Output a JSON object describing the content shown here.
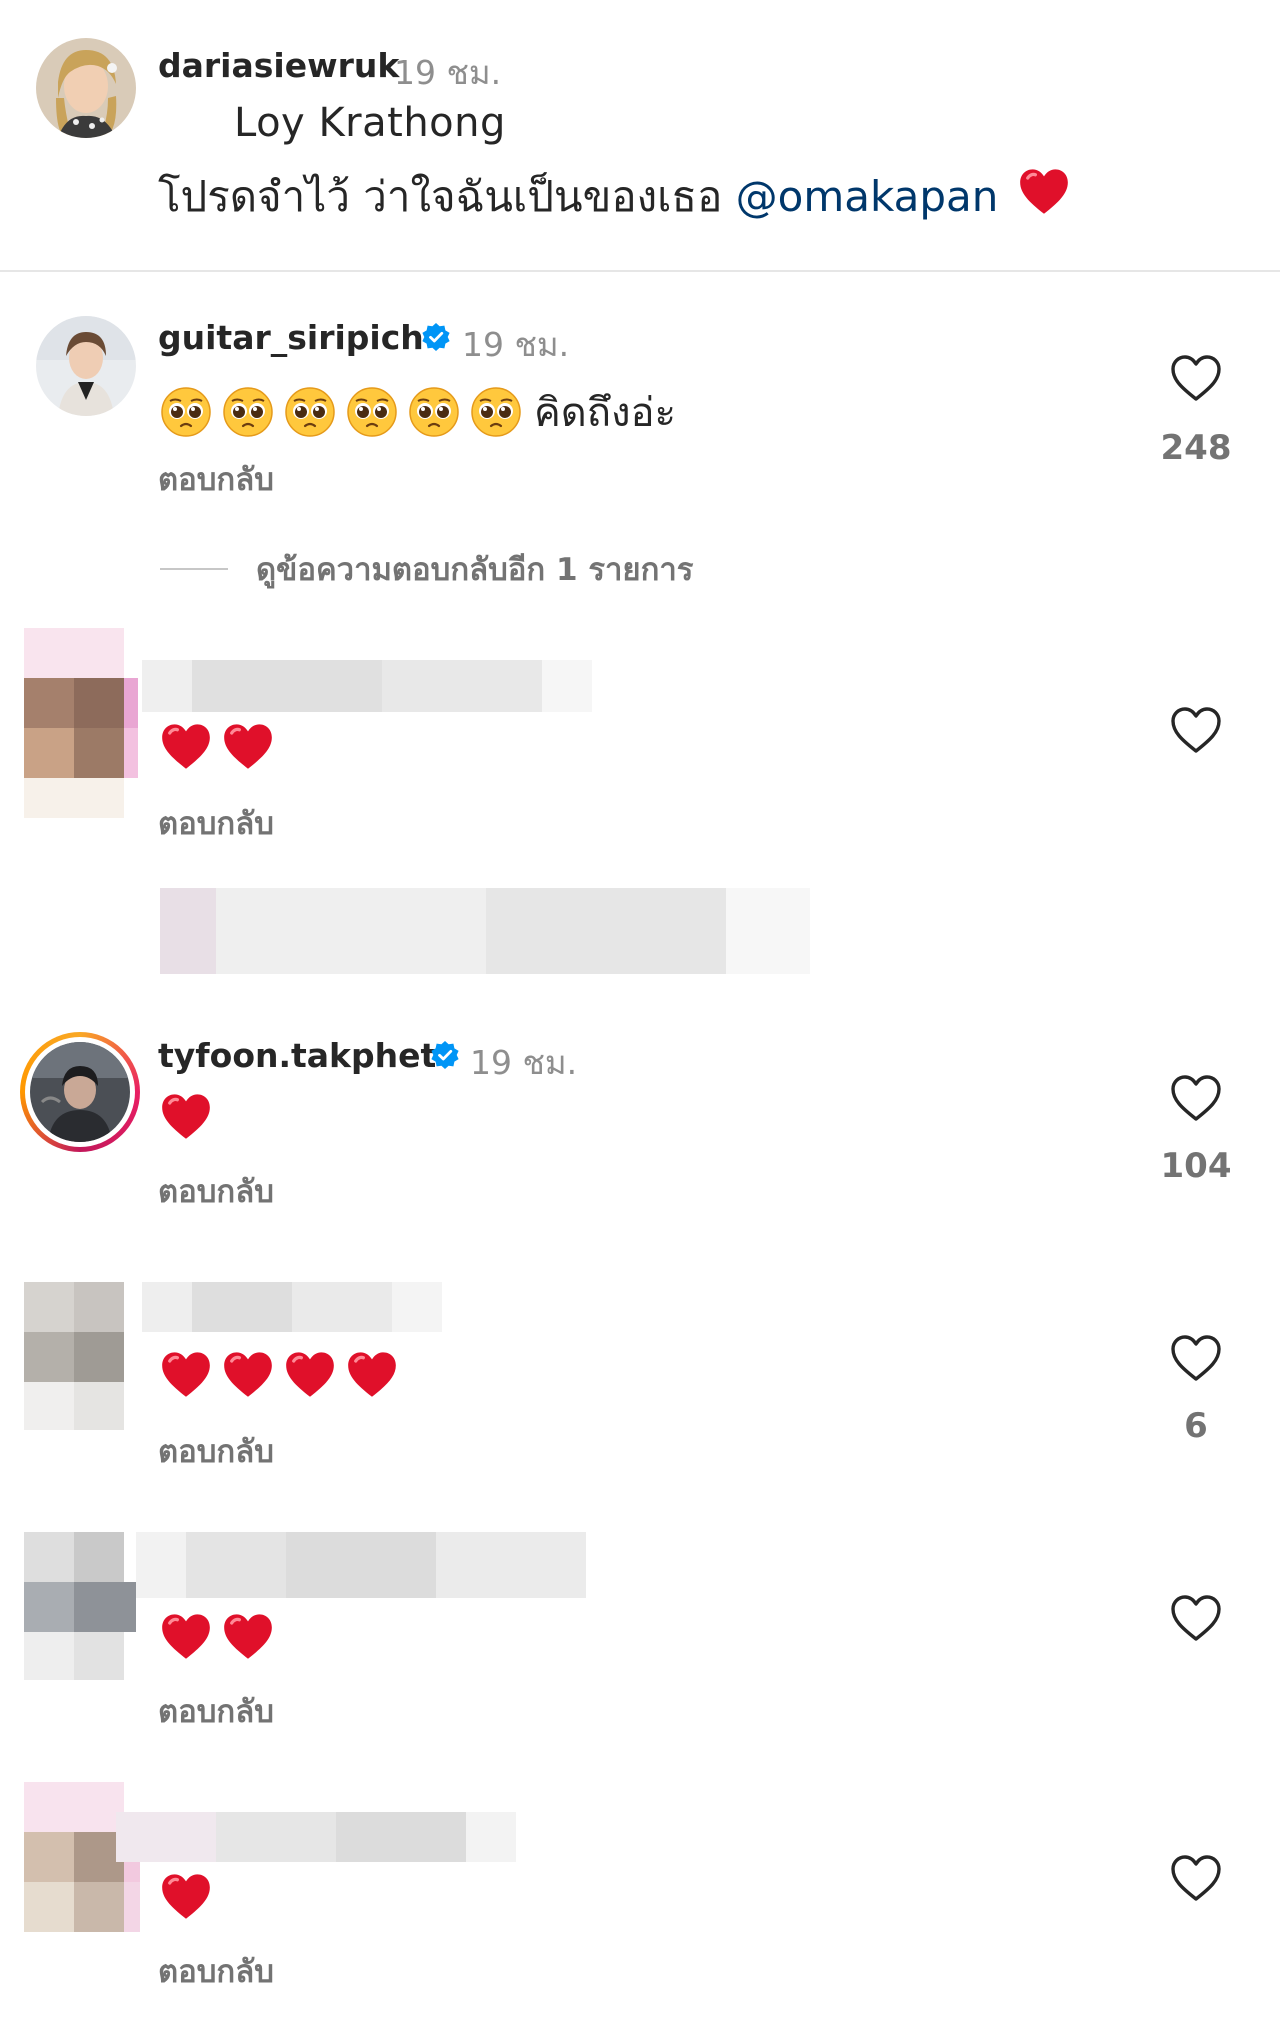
{
  "caption": {
    "username": "dariasiewruk",
    "time": "19 ชม.",
    "line1": "Loy Krathong",
    "line2_text": "โปรดจำไว้ ว่าใจฉันเป็นของเธอ",
    "mention": "@omakapan"
  },
  "comments": [
    {
      "username": "guitar_siripich",
      "verified": true,
      "time": "19 ชม.",
      "text": "คิดถึงอ่ะ",
      "emojis": [
        "pleading-face",
        "pleading-face",
        "pleading-face",
        "pleading-face",
        "pleading-face",
        "pleading-face"
      ],
      "reply_label": "ตอบกลับ",
      "likes": "248",
      "view_replies": "ดูข้อความตอบกลับอีก 1 รายการ"
    },
    {
      "username": "",
      "blurred": true,
      "emojis": [
        "red-heart",
        "red-heart"
      ],
      "reply_label": "ตอบกลับ",
      "likes": ""
    },
    {
      "username": "tyfoon.takphet",
      "verified": true,
      "time": "19 ชม.",
      "emojis": [
        "red-heart"
      ],
      "reply_label": "ตอบกลับ",
      "likes": "104"
    },
    {
      "username": "",
      "blurred": true,
      "emojis": [
        "red-heart",
        "red-heart",
        "red-heart",
        "red-heart"
      ],
      "reply_label": "ตอบกลับ",
      "likes": "6"
    },
    {
      "username": "",
      "blurred": true,
      "emojis": [
        "red-heart",
        "red-heart"
      ],
      "reply_label": "ตอบกลับ",
      "likes": ""
    },
    {
      "username": "",
      "blurred": true,
      "emojis": [
        "red-heart"
      ],
      "reply_label": "ตอบกลับ",
      "likes": ""
    }
  ],
  "colors": {
    "mention": "#00376b",
    "verified": "#0095f6",
    "heart": "#e0102a",
    "muted": "#737373"
  }
}
